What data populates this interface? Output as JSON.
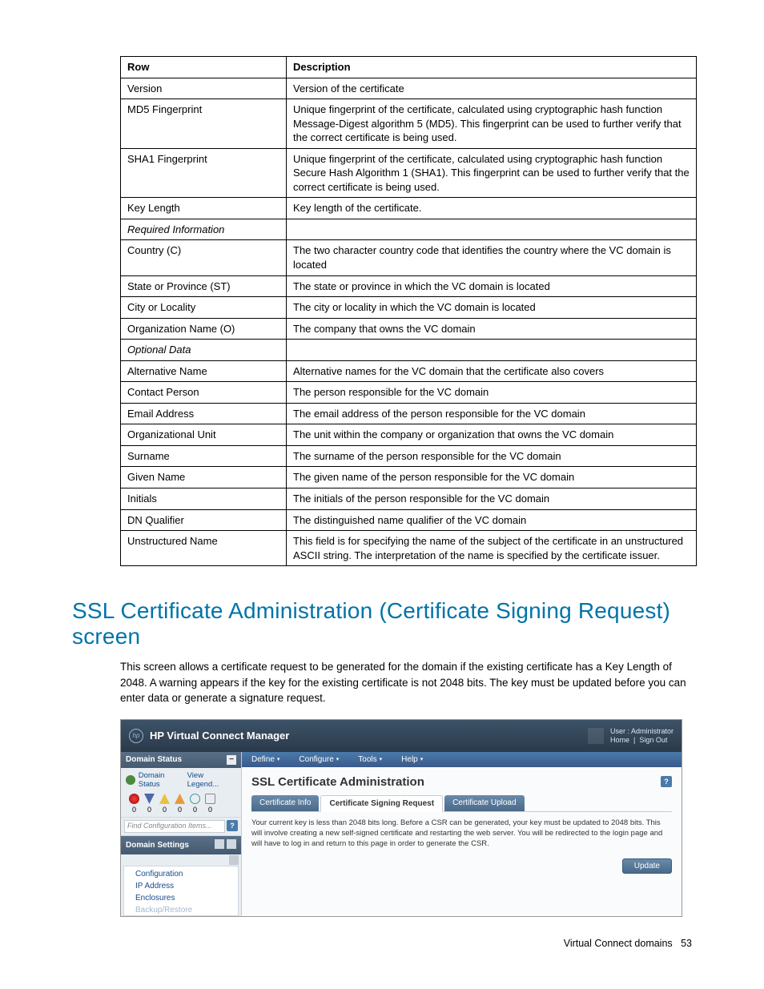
{
  "table": {
    "headers": [
      "Row",
      "Description"
    ],
    "rows": [
      {
        "row": "Version",
        "desc": "Version of the certificate"
      },
      {
        "row": "MD5 Fingerprint",
        "desc": "Unique fingerprint of the certificate, calculated using cryptographic hash function Message-Digest algorithm 5 (MD5). This fingerprint can be used to further verify that the correct certificate is being used."
      },
      {
        "row": "SHA1 Fingerprint",
        "desc": "Unique fingerprint of the certificate, calculated using cryptographic hash function Secure Hash Algorithm 1 (SHA1). This fingerprint can be used to further verify that the correct certificate is being used."
      },
      {
        "row": "Key Length",
        "desc": "Key length of the certificate."
      },
      {
        "row": "Required Information",
        "desc": "",
        "italic": true
      },
      {
        "row": "Country (C)",
        "desc": "The two character country code that identifies the country where the VC domain is located"
      },
      {
        "row": "State or Province (ST)",
        "desc": "The state or province in which the VC domain is located"
      },
      {
        "row": "City or Locality",
        "desc": "The city or locality in which the VC domain is located"
      },
      {
        "row": "Organization Name (O)",
        "desc": "The company that owns the VC domain"
      },
      {
        "row": "Optional Data",
        "desc": "",
        "italic": true
      },
      {
        "row": "Alternative Name",
        "desc": "Alternative names for the VC domain that the certificate also covers"
      },
      {
        "row": "Contact Person",
        "desc": "The person responsible for the VC domain"
      },
      {
        "row": "Email Address",
        "desc": "The email address of the person responsible for the VC domain"
      },
      {
        "row": "Organizational Unit",
        "desc": "The unit within the company or organization that owns the VC domain"
      },
      {
        "row": "Surname",
        "desc": "The surname of the person responsible for the VC domain"
      },
      {
        "row": "Given Name",
        "desc": "The given name of the person responsible for the VC domain"
      },
      {
        "row": "Initials",
        "desc": "The initials of the person responsible for the VC domain"
      },
      {
        "row": "DN Qualifier",
        "desc": "The distinguished name qualifier of the VC domain"
      },
      {
        "row": "Unstructured Name",
        "desc": "This field is for specifying the name of the subject of the certificate in an unstructured ASCII string. The interpretation of the name is specified by the certificate issuer."
      }
    ]
  },
  "heading": "SSL Certificate Administration (Certificate Signing Request) screen",
  "body": "This screen allows a certificate request to be generated for the domain if the existing certificate has a Key Length of 2048. A warning appears if the key for the existing certificate is not 2048 bits. The key must be updated before you can enter data or generate a signature request.",
  "footer": {
    "text": "Virtual Connect domains",
    "page": "53"
  },
  "screenshot": {
    "app_title": "HP Virtual Connect Manager",
    "logo": "hp",
    "user": {
      "label": "User : Administrator",
      "home": "Home",
      "signout": "Sign Out"
    },
    "menubar": [
      "Define",
      "Configure",
      "Tools",
      "Help"
    ],
    "sidebar": {
      "panel1_title": "Domain Status",
      "domain_status": "Domain Status",
      "view_legend": "View Legend...",
      "counts": [
        "0",
        "0",
        "0",
        "0",
        "0",
        "0"
      ],
      "find_placeholder": "Find Configuration Items...",
      "panel2_title": "Domain Settings",
      "tree": [
        "Configuration",
        "IP Address",
        "Enclosures"
      ],
      "tree_last_partial": "Backup/Restore"
    },
    "main": {
      "title": "SSL Certificate Administration",
      "tabs": [
        "Certificate Info",
        "Certificate Signing Request",
        "Certificate Upload"
      ],
      "active_tab": 1,
      "warning": "Your current key is less than 2048 bits long. Before a CSR can be generated, your key must be updated to 2048 bits. This will involve creating a new self-signed certificate and restarting the web server. You will be redirected to the login page and will have to log in and return to this page in order to generate the CSR.",
      "update_btn": "Update"
    }
  }
}
